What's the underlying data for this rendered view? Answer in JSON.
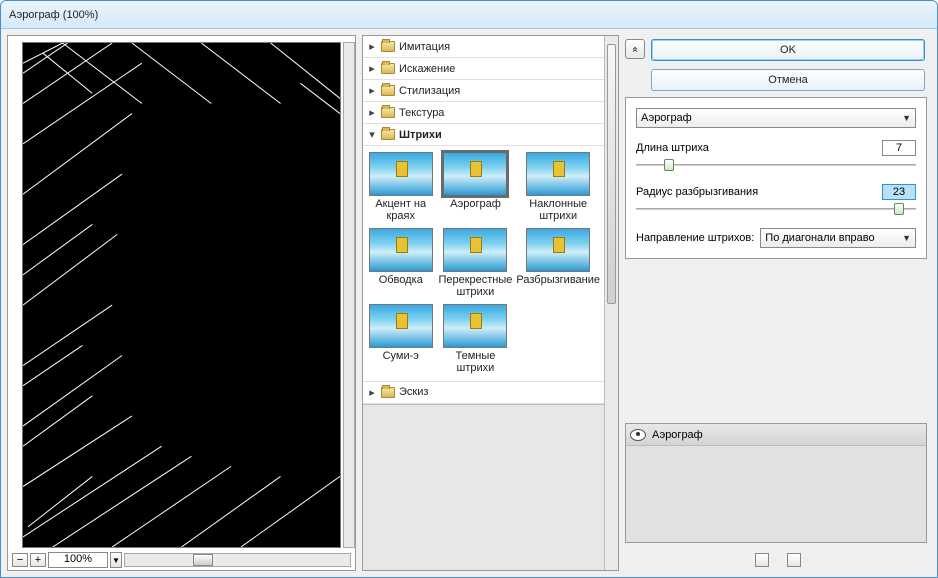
{
  "window": {
    "title": "Аэрограф (100%)"
  },
  "zoom": {
    "value": "100%",
    "minus": "−",
    "plus": "+"
  },
  "categories": [
    {
      "label": "Имитация",
      "expanded": false
    },
    {
      "label": "Искажение",
      "expanded": false
    },
    {
      "label": "Стилизация",
      "expanded": false
    },
    {
      "label": "Текстура",
      "expanded": false
    },
    {
      "label": "Штрихи",
      "expanded": true
    },
    {
      "label": "Эскиз",
      "expanded": false
    }
  ],
  "thumbs": [
    {
      "label": "Акцент на краях"
    },
    {
      "label": "Аэрограф",
      "selected": true
    },
    {
      "label": "Наклонные штрихи"
    },
    {
      "label": "Обводка"
    },
    {
      "label": "Перекрестные штрихи"
    },
    {
      "label": "Разбрызгивание"
    },
    {
      "label": "Суми-э"
    },
    {
      "label": "Темные штрихи"
    }
  ],
  "buttons": {
    "ok": "OK",
    "cancel": "Отмена"
  },
  "collapse_glyph": "«",
  "filter_select": {
    "value": "Аэрограф"
  },
  "params": {
    "stroke_length": {
      "label": "Длина штриха",
      "value": "7",
      "pos_pct": 10
    },
    "spray_radius": {
      "label": "Радиус разбрызгивания",
      "value": "23",
      "pos_pct": 92,
      "highlight": true
    },
    "direction": {
      "label": "Направление штрихов:",
      "value": "По диагонали вправо"
    }
  },
  "layers": {
    "name": "Аэрограф"
  },
  "bottom": {
    "new_icon": "new-layer-icon",
    "trash_icon": "trash-icon"
  }
}
